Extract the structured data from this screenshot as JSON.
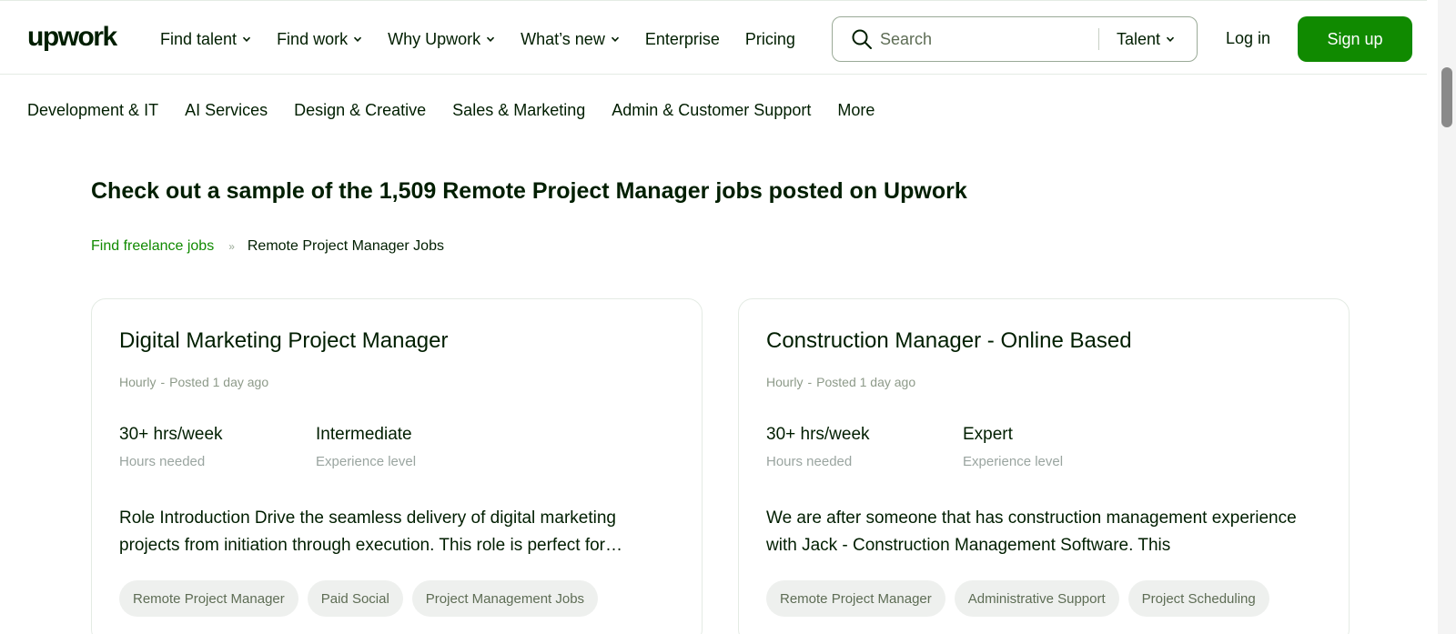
{
  "header": {
    "logo": "upwork",
    "nav": [
      {
        "label": "Find talent",
        "dropdown": true
      },
      {
        "label": "Find work",
        "dropdown": true
      },
      {
        "label": "Why Upwork",
        "dropdown": true
      },
      {
        "label": "What’s new",
        "dropdown": true
      },
      {
        "label": "Enterprise",
        "dropdown": false
      },
      {
        "label": "Pricing",
        "dropdown": false
      }
    ],
    "search": {
      "placeholder": "Search",
      "type_label": "Talent"
    },
    "login_label": "Log in",
    "signup_label": "Sign up"
  },
  "categories": [
    "Development & IT",
    "AI Services",
    "Design & Creative",
    "Sales & Marketing",
    "Admin & Customer Support",
    "More"
  ],
  "main": {
    "heading": "Check out a sample of the 1,509 Remote Project Manager jobs posted on Upwork",
    "breadcrumb": {
      "link": "Find freelance jobs",
      "separator": "»",
      "current": "Remote Project Manager Jobs"
    }
  },
  "jobs": [
    {
      "title": "Digital Marketing Project Manager",
      "type": "Hourly",
      "posted": "Posted 1 day ago",
      "hours_value": "30+ hrs/week",
      "hours_label": "Hours needed",
      "level_value": "Intermediate",
      "level_label": "Experience level",
      "description": "Role Introduction Drive the seamless delivery of digital marketing projects from initiation through execution. This role is perfect for…",
      "skills": [
        "Remote Project Manager",
        "Paid Social",
        "Project Management Jobs"
      ]
    },
    {
      "title": "Construction Manager - Online Based",
      "type": "Hourly",
      "posted": "Posted 1 day ago",
      "hours_value": "30+ hrs/week",
      "hours_label": "Hours needed",
      "level_value": "Expert",
      "level_label": "Experience level",
      "description": "We are after someone that has construction management experience with Jack - Construction Management Software. This",
      "skills": [
        "Remote Project Manager",
        "Administrative Support",
        "Project Scheduling"
      ]
    }
  ],
  "colors": {
    "brand_green": "#108a00",
    "text": "#001e00",
    "muted": "#8d9a89"
  }
}
